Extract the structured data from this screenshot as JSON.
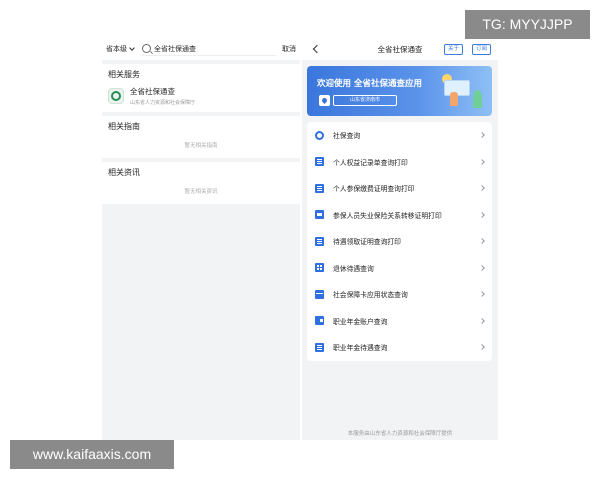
{
  "search_page": {
    "province_label": "省本级",
    "search_value": "全省社保通查",
    "cancel_label": "取消",
    "sections": [
      {
        "title": "相关服务",
        "result": {
          "title": "全省社保通查",
          "subtitle": "山东省人力资源和社会保障厅"
        }
      },
      {
        "title": "相关指南",
        "empty_text": "暂无相关指南"
      },
      {
        "title": "相关资讯",
        "empty_text": "暂无相关资讯"
      }
    ]
  },
  "app_page": {
    "nav_title": "全省社保通查",
    "about_label": "关于",
    "subscribe_label": "订阅",
    "banner": {
      "welcome_text": "欢迎使用 全省社保通查应用",
      "location": "山东省济南市"
    },
    "menu": [
      {
        "label": "社保查询",
        "icon": "social-security-icon"
      },
      {
        "label": "个人权益记录单查询打印",
        "icon": "record-icon"
      },
      {
        "label": "个人参保缴费证明查询打印",
        "icon": "payment-proof-icon"
      },
      {
        "label": "参保人员失业保险关系转移证明打印",
        "icon": "printer-icon"
      },
      {
        "label": "待遇领取证明查询打印",
        "icon": "benefit-proof-icon"
      },
      {
        "label": "退休待遇查询",
        "icon": "retirement-icon"
      },
      {
        "label": "社会保障卡应用状态查询",
        "icon": "card-icon"
      },
      {
        "label": "职业年金账户查询",
        "icon": "wallet-icon"
      },
      {
        "label": "职业年金待遇查询",
        "icon": "annuity-icon"
      }
    ],
    "footer": "本服务由山东省人力资源和社会保障厅提供"
  },
  "watermarks": {
    "top_right": "TG: MYYJJPP",
    "bottom_left": "www.kaifaaxis.com"
  },
  "colors": {
    "accent": "#2f6fe0",
    "banner_start": "#3a76dc",
    "banner_end": "#8ec0f5",
    "page_background": "#f2f3f5",
    "service_logo": "#2e8b57"
  }
}
